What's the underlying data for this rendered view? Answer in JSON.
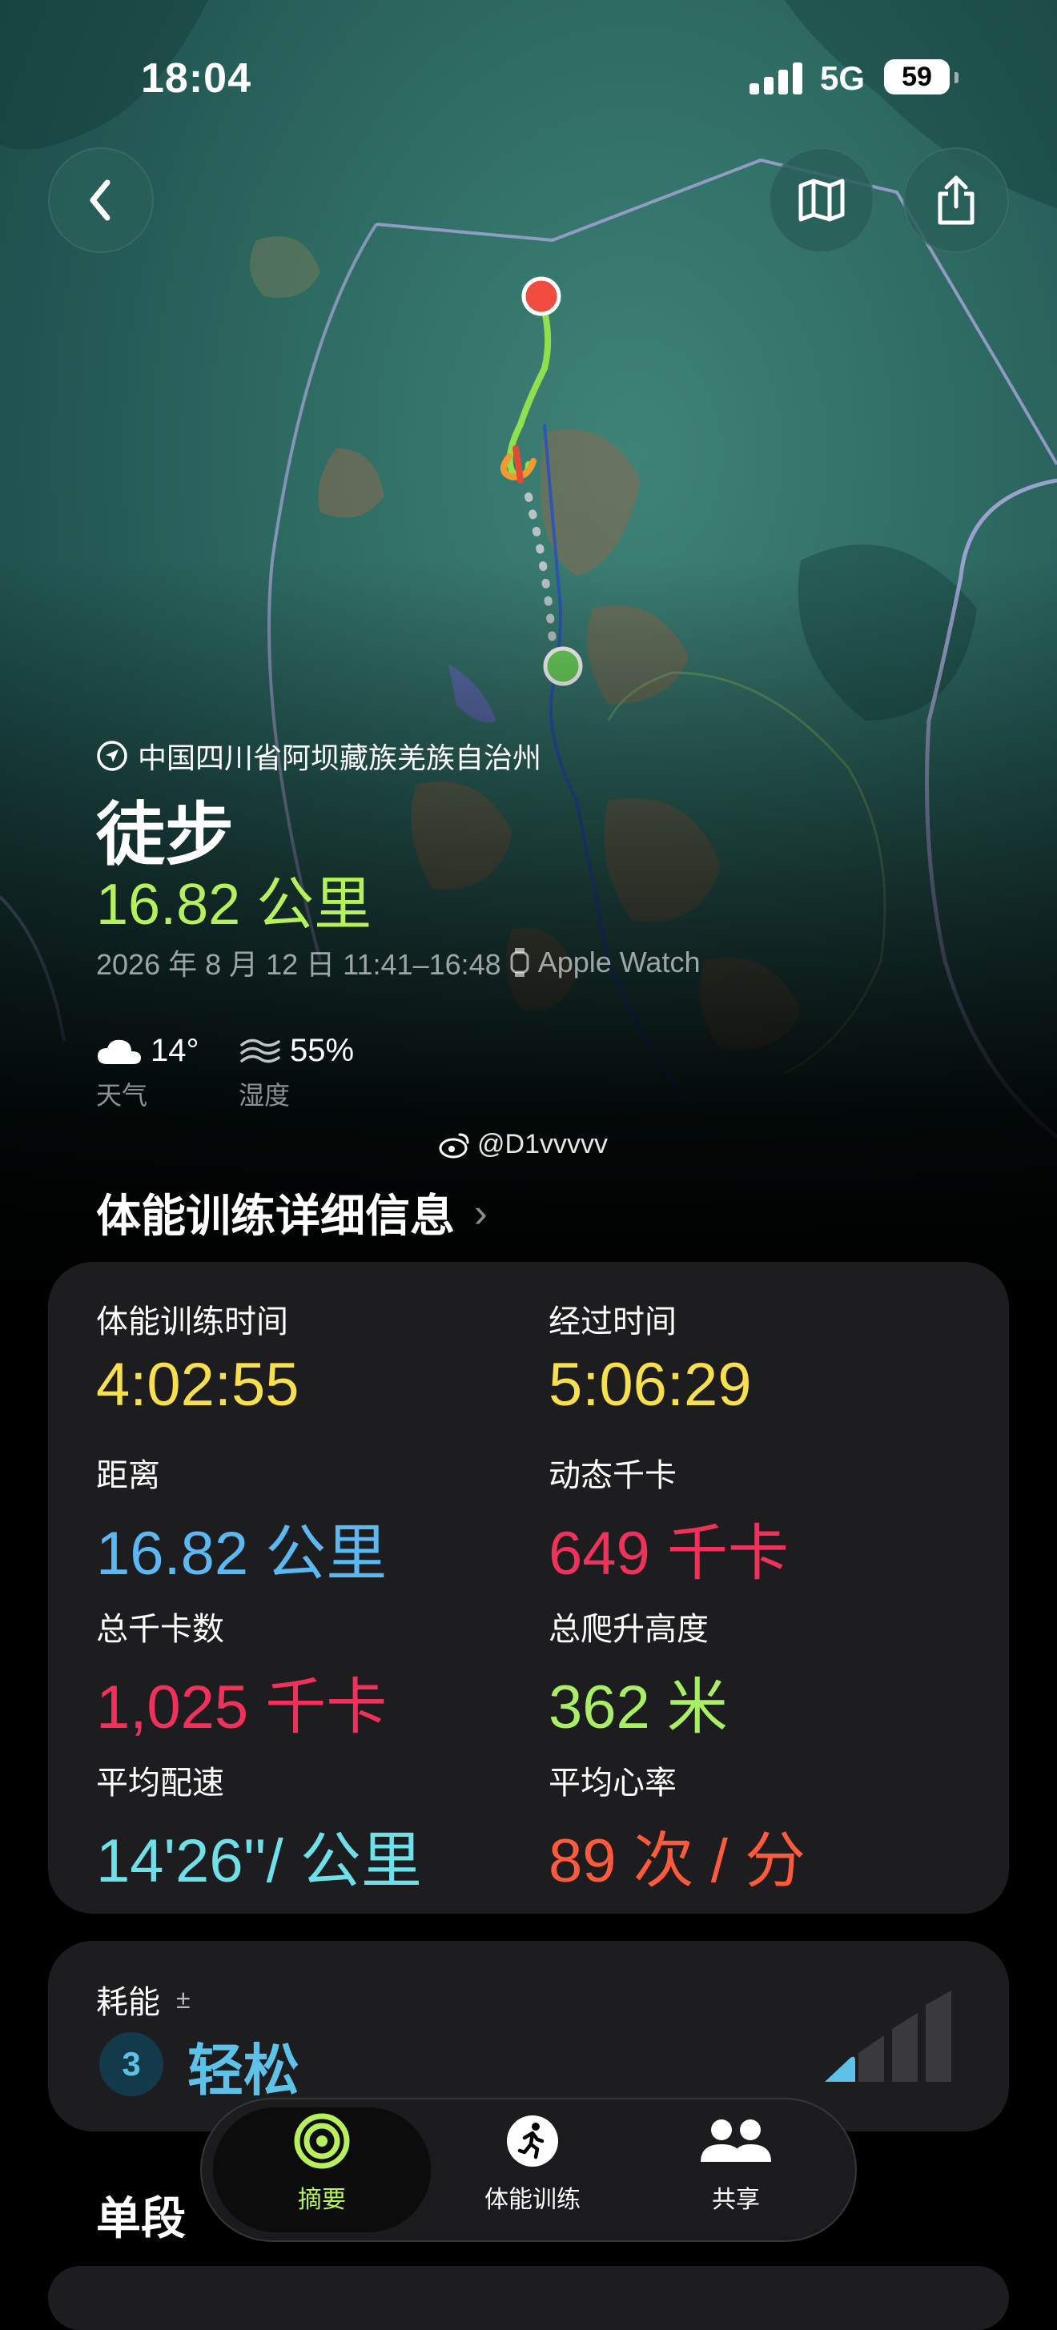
{
  "status_bar": {
    "time": "18:04",
    "network": "5G",
    "battery": "59"
  },
  "workout": {
    "location": "中国四川省阿坝藏族羌族自治州",
    "type": "徒步",
    "distance": "16.82 公里",
    "date_range": "2026 年 8 月 12 日 11:41–16:48",
    "device": "Apple Watch"
  },
  "weather": {
    "temperature": "14°",
    "temperature_label": "天气",
    "humidity": "55%",
    "humidity_label": "湿度"
  },
  "watermark": "@D1vvvvv",
  "details": {
    "section_title": "体能训练详细信息",
    "metrics": [
      {
        "label": "体能训练时间",
        "value": "4:02:55",
        "color": "#f7df4e"
      },
      {
        "label": "经过时间",
        "value": "5:06:29",
        "color": "#f7df4e"
      },
      {
        "label": "距离",
        "value": "16.82 公里",
        "color": "#5cb8f2"
      },
      {
        "label": "动态千卡",
        "value": "649 千卡",
        "color": "#f1315a"
      },
      {
        "label": "总千卡数",
        "value": "1,025 千卡",
        "color": "#f1315a"
      },
      {
        "label": "总爬升高度",
        "value": "362 米",
        "color": "#a8ef64"
      },
      {
        "label": "平均配速",
        "value": "14'26''/ 公里",
        "color": "#6ee0e9"
      },
      {
        "label": "平均心率",
        "value": "89 次 / 分",
        "color": "#ff5a3c"
      }
    ]
  },
  "effort": {
    "label": "耗能",
    "adjust_symbol": "±",
    "score": "3",
    "level": "轻松",
    "level_fraction": 0.2
  },
  "tabbar": {
    "tabs": [
      "摘要",
      "体能训练",
      "共享"
    ],
    "active": "摘要"
  },
  "next_section": "单段",
  "colors": {
    "route_start": "#6cd35c",
    "route_end": "#f24b3f",
    "accent_green": "#b6f05a"
  }
}
